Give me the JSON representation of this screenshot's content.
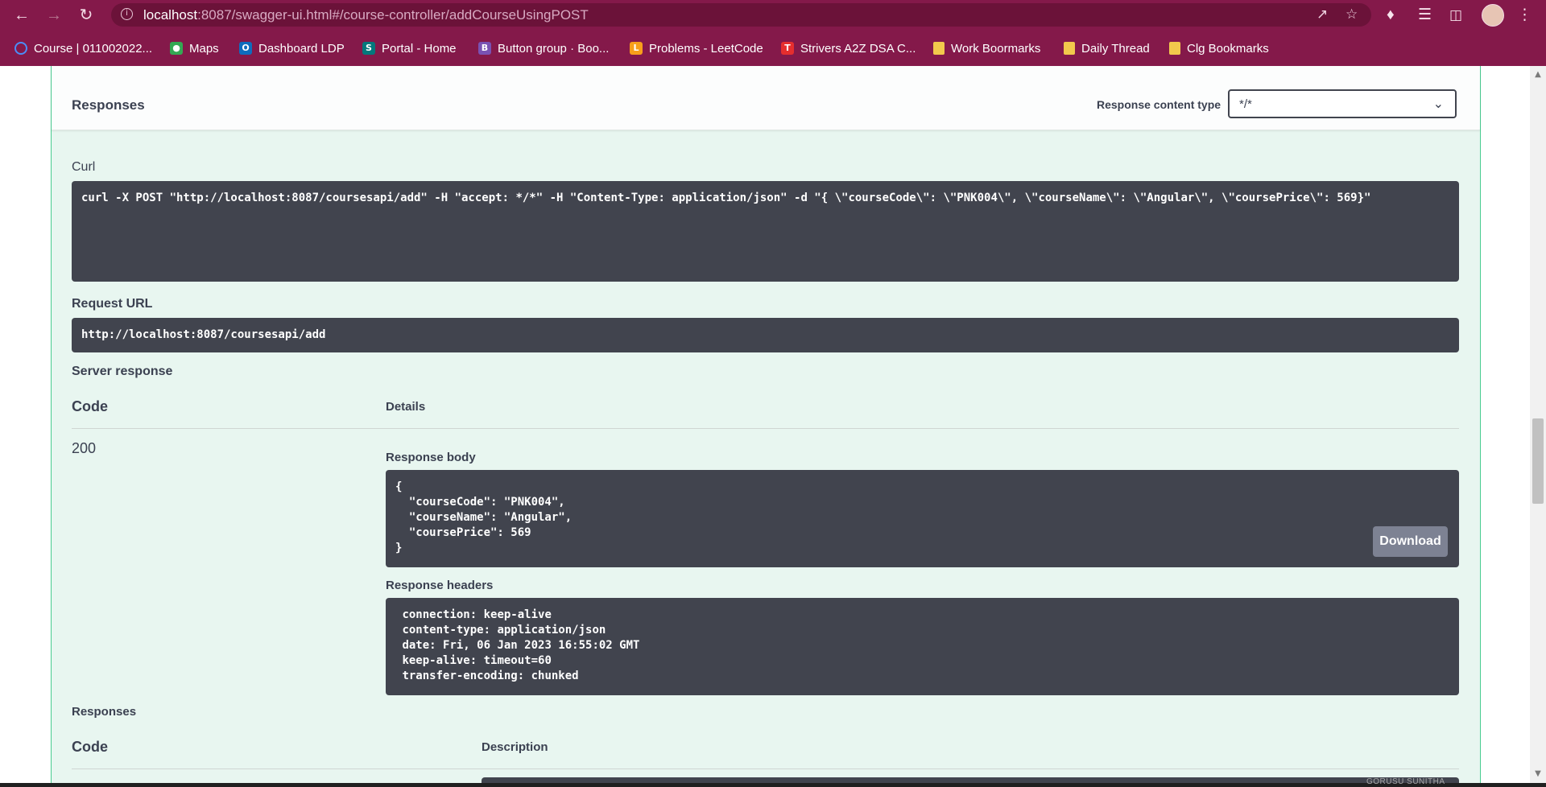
{
  "browser": {
    "url_host": "localhost",
    "url_path": ":8087/swagger-ui.html#/course-controller/addCourseUsingPOST",
    "bookmarks": [
      {
        "label": "Course | 011002022...",
        "icon": "circle-o-icon",
        "color": "#4b8df8"
      },
      {
        "label": "Maps",
        "icon": "maps-pin-icon",
        "color": "#34a853"
      },
      {
        "label": "Dashboard LDP",
        "icon": "outlook-icon",
        "color": "#0f6cbd"
      },
      {
        "label": "Portal - Home",
        "icon": "sharepoint-icon",
        "color": "#03787c"
      },
      {
        "label": "Button group · Boo...",
        "icon": "bootstrap-icon",
        "color": "#7952b3"
      },
      {
        "label": "Problems - LeetCode",
        "icon": "leetcode-icon",
        "color": "#f89f1b"
      },
      {
        "label": "Strivers A2Z DSA C...",
        "icon": "tuf-icon",
        "color": "#e52e2e"
      },
      {
        "label": "Work Boormarks",
        "icon": "folder-icon",
        "color": "#f2c94c"
      },
      {
        "label": "Daily Thread",
        "icon": "folder-icon",
        "color": "#f2c94c"
      },
      {
        "label": "Clg Bookmarks",
        "icon": "folder-icon",
        "color": "#f2c94c"
      }
    ]
  },
  "responses_header": {
    "title": "Responses",
    "content_type_label": "Response content type",
    "content_type_value": "*/*"
  },
  "curl": {
    "label": "Curl",
    "command": "curl -X POST \"http://localhost:8087/coursesapi/add\" -H \"accept: */*\" -H \"Content-Type: application/json\" -d \"{ \\\"courseCode\\\": \\\"PNK004\\\", \\\"courseName\\\": \\\"Angular\\\", \\\"coursePrice\\\": 569}\""
  },
  "request_url": {
    "label": "Request URL",
    "value": "http://localhost:8087/coursesapi/add"
  },
  "server_response": {
    "label": "Server response",
    "col_code": "Code",
    "col_details": "Details",
    "status_code": "200",
    "body_label": "Response body",
    "body": "{\n  \"courseCode\": \"PNK004\",\n  \"courseName\": \"Angular\",\n  \"coursePrice\": 569\n}",
    "download_label": "Download",
    "headers_label": "Response headers",
    "headers": " connection: keep-alive \n content-type: application/json \n date: Fri, 06 Jan 2023 16:55:02 GMT \n keep-alive: timeout=60 \n transfer-encoding: chunked "
  },
  "responses_table": {
    "label": "Responses",
    "col_code": "Code",
    "col_description": "Description"
  },
  "watermark": "GORUSU SUNITHA"
}
